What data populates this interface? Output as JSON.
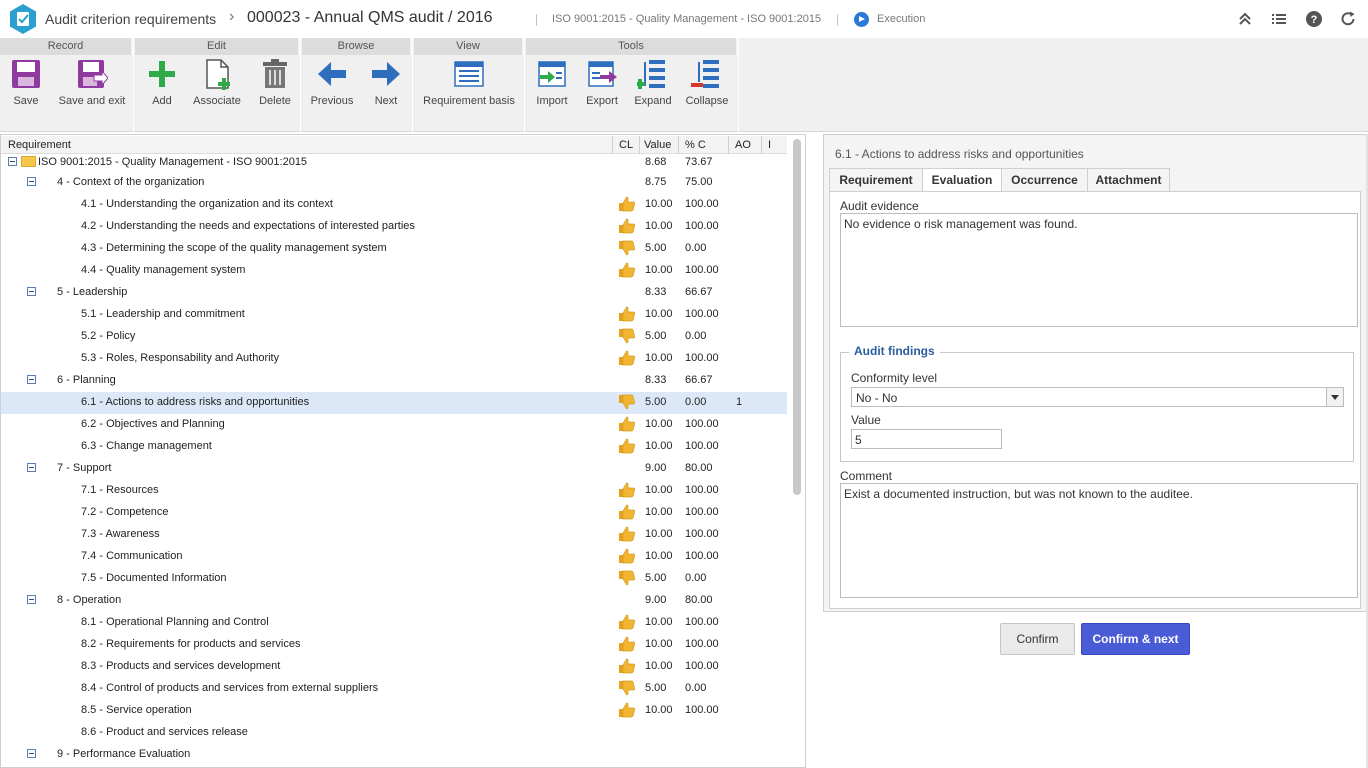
{
  "header": {
    "app_title": "Audit criterion requirements",
    "record_title": "000023 - Annual QMS audit / 2016",
    "standard": "ISO 9001:2015 - Quality Management - ISO 9001:2015",
    "status": "Execution"
  },
  "toolbar": {
    "groups": [
      "Record",
      "Edit",
      "Browse",
      "View",
      "Tools"
    ],
    "save": "Save",
    "save_exit": "Save and exit",
    "add": "Add",
    "associate": "Associate",
    "delete": "Delete",
    "previous": "Previous",
    "next": "Next",
    "requirement_basis": "Requirement basis",
    "import": "Import",
    "export": "Export",
    "expand": "Expand",
    "collapse": "Collapse"
  },
  "tree": {
    "columns": {
      "requirement": "Requirement",
      "cl": "CL",
      "value": "Value",
      "pct": "% C",
      "ao": "AO",
      "i": "I"
    },
    "rows": [
      {
        "level": 0,
        "label": "ISO 9001:2015 - Quality Management - ISO 9001:2015",
        "value": "8.68",
        "pct": "73.67",
        "ao": "",
        "cl": ""
      },
      {
        "level": 1,
        "label": "4 - Context of the organization",
        "value": "8.75",
        "pct": "75.00",
        "ao": "",
        "cl": ""
      },
      {
        "level": 2,
        "label": "4.1 - Understanding the organization and its context",
        "value": "10.00",
        "pct": "100.00",
        "ao": "",
        "cl": "up"
      },
      {
        "level": 2,
        "label": "4.2 - Understanding the needs and expectations of interested parties",
        "value": "10.00",
        "pct": "100.00",
        "ao": "",
        "cl": "up"
      },
      {
        "level": 2,
        "label": "4.3 - Determining the scope of the quality management system",
        "value": "5.00",
        "pct": "0.00",
        "ao": "",
        "cl": "down"
      },
      {
        "level": 2,
        "label": "4.4 - Quality management system",
        "value": "10.00",
        "pct": "100.00",
        "ao": "",
        "cl": "up"
      },
      {
        "level": 1,
        "label": "5 - Leadership",
        "value": "8.33",
        "pct": "66.67",
        "ao": "",
        "cl": ""
      },
      {
        "level": 2,
        "label": "5.1 - Leadership and commitment",
        "value": "10.00",
        "pct": "100.00",
        "ao": "",
        "cl": "up"
      },
      {
        "level": 2,
        "label": "5.2 - Policy",
        "value": "5.00",
        "pct": "0.00",
        "ao": "",
        "cl": "down"
      },
      {
        "level": 2,
        "label": "5.3 - Roles, Responsability and Authority",
        "value": "10.00",
        "pct": "100.00",
        "ao": "",
        "cl": "up"
      },
      {
        "level": 1,
        "label": "6 - Planning",
        "value": "8.33",
        "pct": "66.67",
        "ao": "",
        "cl": ""
      },
      {
        "level": 2,
        "label": "6.1 - Actions to address risks and opportunities",
        "value": "5.00",
        "pct": "0.00",
        "ao": "1",
        "cl": "down",
        "selected": true
      },
      {
        "level": 2,
        "label": "6.2 - Objectives and Planning",
        "value": "10.00",
        "pct": "100.00",
        "ao": "",
        "cl": "up"
      },
      {
        "level": 2,
        "label": "6.3 - Change management",
        "value": "10.00",
        "pct": "100.00",
        "ao": "",
        "cl": "up"
      },
      {
        "level": 1,
        "label": "7 - Support",
        "value": "9.00",
        "pct": "80.00",
        "ao": "",
        "cl": ""
      },
      {
        "level": 2,
        "label": "7.1 - Resources",
        "value": "10.00",
        "pct": "100.00",
        "ao": "",
        "cl": "up"
      },
      {
        "level": 2,
        "label": "7.2 - Competence",
        "value": "10.00",
        "pct": "100.00",
        "ao": "",
        "cl": "up"
      },
      {
        "level": 2,
        "label": "7.3 - Awareness",
        "value": "10.00",
        "pct": "100.00",
        "ao": "",
        "cl": "up"
      },
      {
        "level": 2,
        "label": "7.4 - Communication",
        "value": "10.00",
        "pct": "100.00",
        "ao": "",
        "cl": "up"
      },
      {
        "level": 2,
        "label": "7.5 - Documented Information",
        "value": "5.00",
        "pct": "0.00",
        "ao": "",
        "cl": "down"
      },
      {
        "level": 1,
        "label": "8 - Operation",
        "value": "9.00",
        "pct": "80.00",
        "ao": "",
        "cl": ""
      },
      {
        "level": 2,
        "label": "8.1 - Operational Planning and Control",
        "value": "10.00",
        "pct": "100.00",
        "ao": "",
        "cl": "up"
      },
      {
        "level": 2,
        "label": "8.2 - Requirements for products and services",
        "value": "10.00",
        "pct": "100.00",
        "ao": "",
        "cl": "up"
      },
      {
        "level": 2,
        "label": "8.3 - Products and services development",
        "value": "10.00",
        "pct": "100.00",
        "ao": "",
        "cl": "up"
      },
      {
        "level": 2,
        "label": "8.4 - Control of products and services from external suppliers",
        "value": "5.00",
        "pct": "0.00",
        "ao": "",
        "cl": "down"
      },
      {
        "level": 2,
        "label": "8.5 - Service operation",
        "value": "10.00",
        "pct": "100.00",
        "ao": "",
        "cl": "up"
      },
      {
        "level": 2,
        "label": "8.6 - Product and services release",
        "value": "",
        "pct": "",
        "ao": "",
        "cl": ""
      },
      {
        "level": 1,
        "label": "9 - Performance Evaluation",
        "value": "",
        "pct": "",
        "ao": "",
        "cl": ""
      }
    ]
  },
  "detail": {
    "title": "6.1 - Actions to address risks and opportunities",
    "tabs": [
      "Requirement",
      "Evaluation",
      "Occurrence",
      "Attachment"
    ],
    "active_tab": "Evaluation",
    "audit_evidence_label": "Audit evidence",
    "audit_evidence": "No evidence o risk management was found.",
    "findings_legend": "Audit findings",
    "conformity_label": "Conformity level",
    "conformity_value": "No - No",
    "value_label": "Value",
    "value": "5",
    "comment_label": "Comment",
    "comment": "Exist a documented instruction, but was not known to the auditee."
  },
  "buttons": {
    "confirm": "Confirm",
    "confirm_next": "Confirm & next"
  },
  "colors": {
    "accent": "#4a5bd6",
    "save_icon": "#8e3a9e",
    "add_icon": "#2eaa4a",
    "nav_arrow": "#2f6dbf",
    "thumb": "#f2b531",
    "selected_row": "#dce8f7"
  }
}
